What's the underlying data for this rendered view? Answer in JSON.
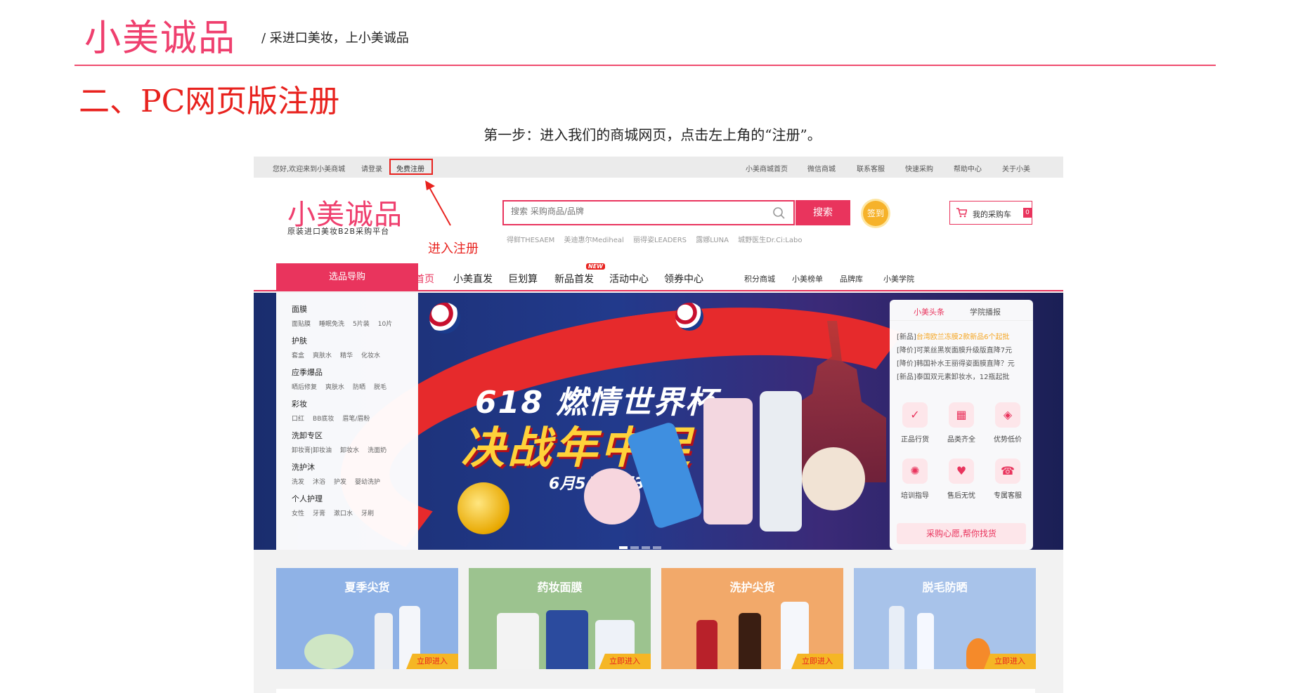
{
  "doc": {
    "logo": "小美诚品",
    "slogan": "/ 采进口美妆，上小美诚品",
    "heading": "二、PC网页版注册",
    "step": "第一步：进入我们的商城网页，点击左上角的“注册”。"
  },
  "topbar": {
    "welcome": "您好,欢迎来到小美商城",
    "login": "请登录",
    "register": "免费注册",
    "links": [
      "小美商城首页",
      "微信商城",
      "联系客服",
      "快速采购",
      "帮助中心",
      "关于小美"
    ]
  },
  "header": {
    "logo": "小美诚品",
    "tagline": "原装进口美妆B2B采购平台",
    "annotation": "进入注册",
    "search_placeholder": "搜索 采购商品/品牌",
    "search_button": "搜索",
    "hot_words": [
      "得鲜THESAEM",
      "美迪惠尔Mediheal",
      "丽得姿LEADERS",
      "露娜LUNA",
      "城野医生Dr.Ci:Labo"
    ],
    "signin": "签到",
    "cart_label": "我的采购车",
    "cart_count": "0"
  },
  "nav": {
    "category_button": "选品导购",
    "main_items": [
      "首页",
      "小美直发",
      "巨划算",
      "新品首发",
      "活动中心",
      "领券中心"
    ],
    "new_tag": "NEW",
    "minor_items": [
      "积分商城",
      "小美榜单",
      "品牌库",
      "小美学院"
    ]
  },
  "categories": [
    {
      "title": "面膜",
      "items": [
        "面贴膜",
        "睡眠免洗",
        "5片装",
        "10片"
      ]
    },
    {
      "title": "护肤",
      "items": [
        "套盒",
        "爽肤水",
        "精华",
        "化妆水"
      ]
    },
    {
      "title": "应季爆品",
      "items": [
        "晒后修复",
        "爽肤水",
        "防晒",
        "脱毛"
      ]
    },
    {
      "title": "彩妆",
      "items": [
        "口红",
        "BB底妆",
        "眉笔/眉粉"
      ]
    },
    {
      "title": "洗卸专区",
      "items": [
        "卸妆膏|卸妆油",
        "卸妆水",
        "洗面奶"
      ]
    },
    {
      "title": "洗护沐",
      "items": [
        "洗发",
        "沐浴",
        "护发",
        "婴幼洗护"
      ]
    },
    {
      "title": "个人护理",
      "items": [
        "女性",
        "牙膏",
        "漱口水",
        "牙刷"
      ]
    }
  ],
  "banner": {
    "line1": "618 燃情世界杯",
    "line2": "决战年中促",
    "line3": "6月5日-6月30日"
  },
  "news": {
    "tabs": [
      "小美头条",
      "学院播报"
    ],
    "items": [
      {
        "tag": "[新品]",
        "text": "台湾欧兰冻膜2款新品6个起批"
      },
      {
        "tag": "[降价]",
        "text": "可莱丝黑炭面膜升级版直降7元"
      },
      {
        "tag": "[降价]",
        "text": "韩国补水王丽得姿面膜直降？元"
      },
      {
        "tag": "[新品]",
        "text": "泰国双元素卸妆水，12瓶起批"
      }
    ],
    "services": [
      "正品行货",
      "品类齐全",
      "优势低价",
      "培训指导",
      "售后无忧",
      "专属客服"
    ],
    "wish": "采购心愿,帮你找货"
  },
  "tiles": [
    {
      "title": "夏季尖货",
      "button": "立即进入",
      "color": "#8fb2e6"
    },
    {
      "title": "药妆面膜",
      "button": "立即进入",
      "color": "#9cc38f"
    },
    {
      "title": "洗护尖货",
      "button": "立即进入",
      "color": "#f2a96a"
    },
    {
      "title": "脱毛防晒",
      "button": "立即进入",
      "color": "#a8c3ea"
    }
  ]
}
